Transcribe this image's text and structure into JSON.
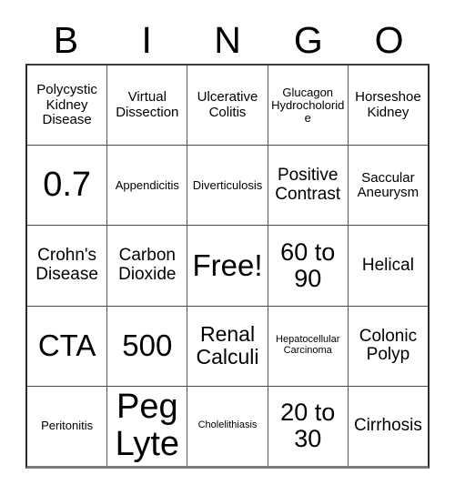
{
  "card": {
    "header_letters": [
      "B",
      "I",
      "N",
      "G",
      "O"
    ],
    "rows": [
      [
        {
          "text": "Polycystic Kidney Disease",
          "size": "sm"
        },
        {
          "text": "Virtual Dissection",
          "size": "sm"
        },
        {
          "text": "Ulcerative Colitis",
          "size": "sm"
        },
        {
          "text": "Glucagon Hydrocholoride",
          "size": "xs"
        },
        {
          "text": "Horseshoe Kidney",
          "size": "sm"
        }
      ],
      [
        {
          "text": "0.7",
          "size": "huge"
        },
        {
          "text": "Appendicitis",
          "size": "xs"
        },
        {
          "text": "Diverticulosis",
          "size": "xs"
        },
        {
          "text": "Positive Contrast",
          "size": "md"
        },
        {
          "text": "Saccular Aneurysm",
          "size": "sm"
        }
      ],
      [
        {
          "text": "Crohn's Disease",
          "size": "md"
        },
        {
          "text": "Carbon Dioxide",
          "size": "md"
        },
        {
          "text": "Free!",
          "size": "xxl"
        },
        {
          "text": "60 to 90",
          "size": "xl"
        },
        {
          "text": "Helical",
          "size": "md"
        }
      ],
      [
        {
          "text": "CTA",
          "size": "xxl"
        },
        {
          "text": "500",
          "size": "xxl"
        },
        {
          "text": "Renal Calculi",
          "size": "lg"
        },
        {
          "text": "Hepatocellular Carcinoma",
          "size": "xxs"
        },
        {
          "text": "Colonic Polyp",
          "size": "md"
        }
      ],
      [
        {
          "text": "Peritonitis",
          "size": "xs"
        },
        {
          "text": "Peg Lyte",
          "size": "huge"
        },
        {
          "text": "Cholelithiasis",
          "size": "xxs"
        },
        {
          "text": "20 to 30",
          "size": "xl"
        },
        {
          "text": "Cirrhosis",
          "size": "md"
        }
      ]
    ]
  },
  "colors": {
    "background": "#ffffff",
    "text": "#000000",
    "grid_border": "#2b2b2b",
    "grid_inner_line": "#5a5a5a"
  }
}
